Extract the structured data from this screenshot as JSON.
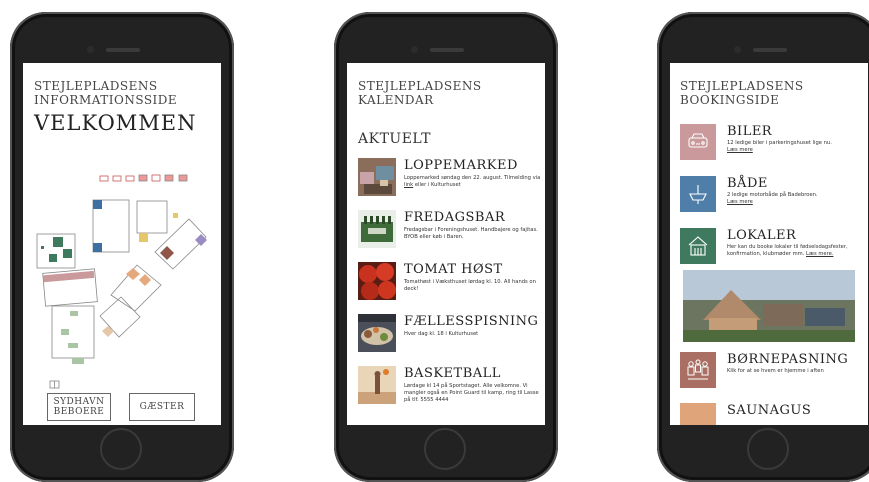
{
  "info": {
    "kicker_line1": "STEJLEPLADSENS",
    "kicker_line2": "INFORMATIONSSIDE",
    "welcome": "VELKOMMEN",
    "btn_residents_line1": "SYDHAVN",
    "btn_residents_line2": "BEBOERE",
    "btn_guests": "GÆSTER"
  },
  "calendar": {
    "kicker_line1": "STEJLEPLADSENS",
    "kicker_line2": "KALENDAR",
    "section": "AKTUELT",
    "events": [
      {
        "title": "LOPPEMARKED",
        "desc_1": "Loppemarked søndag den 22. august. Tilmelding via ",
        "desc_link": "link",
        "desc_2": " eller i Kulturhuset"
      },
      {
        "title": "FREDAGSBAR",
        "desc_1": "Fredagsbar i Foreningshuset. Handbajere og fajitas. BYOB eller køb i Baren.",
        "desc_link": "",
        "desc_2": ""
      },
      {
        "title": "TOMAT HØST",
        "desc_1": "Tomathøst i Væksthuset lørdag kl. 10. All hands on deck!",
        "desc_link": "",
        "desc_2": ""
      },
      {
        "title": "FÆLLESSPISNING",
        "desc_1": "Hver dag kl. 18 i Kulturhuset",
        "desc_link": "",
        "desc_2": ""
      },
      {
        "title": "BASKETBALL",
        "desc_1": "Lørdage kl 14 på Sportstaget. Alle velkomne. Vi mangler også en Point Guard til kamp, ring til Lasse på tlf. 5555 4444",
        "desc_link": "",
        "desc_2": ""
      }
    ]
  },
  "booking": {
    "kicker_line1": "STEJLEPLADSENS",
    "kicker_line2": "BOOKINGSIDE",
    "items": [
      {
        "title": "BILER",
        "desc": "12 ledige biler i parkeringshuset lige nu.",
        "more": "Læs mere",
        "color": "#c9999b",
        "icon": "car-icon"
      },
      {
        "title": "BÅDE",
        "desc": "2 ledige motorbåde på Badebroen.",
        "more": "Læs mere",
        "color": "#4f7fa8",
        "icon": "boat-icon"
      },
      {
        "title": "LOKALER",
        "desc": "Her kan du booke lokaler til fødselsdagsfester, konfirmation, klubmøder mm.",
        "more": "Læs mere.",
        "color": "#3f7a5f",
        "icon": "house-icon"
      },
      {
        "title": "BØRNEPASNING",
        "desc": "Klik for at se hvem er hjemme i aften",
        "more": "",
        "color": "#a86f62",
        "icon": "family-icon"
      },
      {
        "title": "SAUNAGUS",
        "desc": "",
        "more": "",
        "color": "#e0a47a",
        "icon": "sauna-icon"
      }
    ]
  }
}
